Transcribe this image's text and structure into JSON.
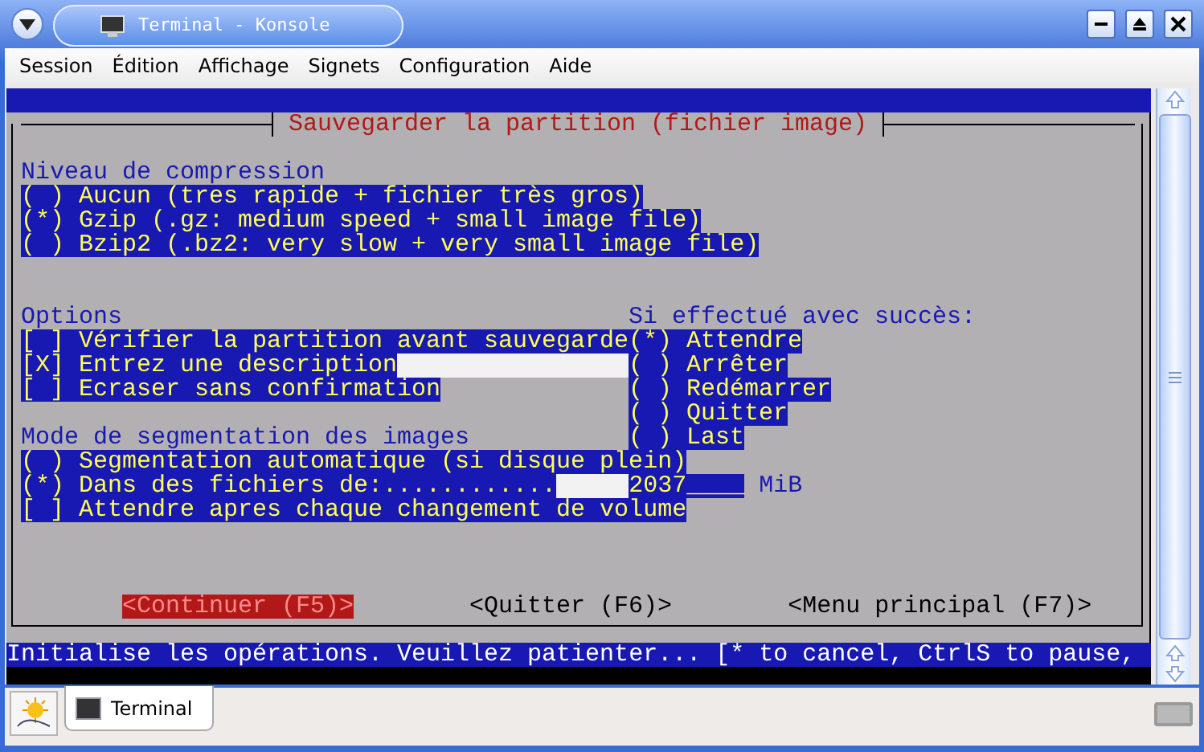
{
  "window": {
    "title": "Terminal - Konsole"
  },
  "menu": [
    "Session",
    "Édition",
    "Affichage",
    "Signets",
    "Configuration",
    "Aide"
  ],
  "dialog": {
    "title": "Sauvegarder la partition (fichier image)",
    "compression": {
      "label": "Niveau de compression",
      "items": [
        {
          "marker": "( )",
          "text": "Aucun (tres rapide + fichier très gros)"
        },
        {
          "marker": "(*)",
          "text": "Gzip (.gz: medium speed + small image file)"
        },
        {
          "marker": "( )",
          "text": "Bzip2 (.bz2: very slow + very small image file)"
        }
      ]
    },
    "options": {
      "label": "Options",
      "items": [
        {
          "kind": "plain",
          "marker": "[ ]",
          "text": "Vérifier la partition avant sauvegarde"
        },
        {
          "kind": "field",
          "marker": "[X]",
          "text": "Entrez une description"
        },
        {
          "kind": "plain",
          "marker": "[ ]",
          "text": "Ecraser sans confirmation"
        }
      ]
    },
    "success": {
      "label": "Si effectué avec succès:",
      "items": [
        {
          "marker": "(*)",
          "text": "Attendre"
        },
        {
          "marker": "( )",
          "text": "Arrêter"
        },
        {
          "marker": "( )",
          "text": "Redémarrer"
        },
        {
          "marker": "( )",
          "text": "Quitter"
        },
        {
          "marker": "( )",
          "text": "Last"
        }
      ]
    },
    "segmentation": {
      "label": "Mode de segmentation des images",
      "items": [
        {
          "marker": "( )",
          "text": "Segmentation automatique (si disque plein)"
        },
        {
          "marker": "(*)",
          "text": "Dans des fichiers de:............",
          "value": "2037____",
          "unit": "MiB"
        },
        {
          "marker": "[ ]",
          "text": "Attendre apres chaque changement de volume"
        }
      ]
    },
    "buttons": [
      {
        "label": "<Continuer (F5)>",
        "selected": true
      },
      {
        "label": "<Quitter (F6)>",
        "selected": false
      },
      {
        "label": "<Menu principal (F7)>",
        "selected": false
      }
    ]
  },
  "status_line": "Initialise les opérations. Veuillez patienter... [* to cancel, CtrlS to pause,",
  "taskbar": {
    "tasks": [
      {
        "label": "Terminal",
        "selected": true
      }
    ]
  }
}
